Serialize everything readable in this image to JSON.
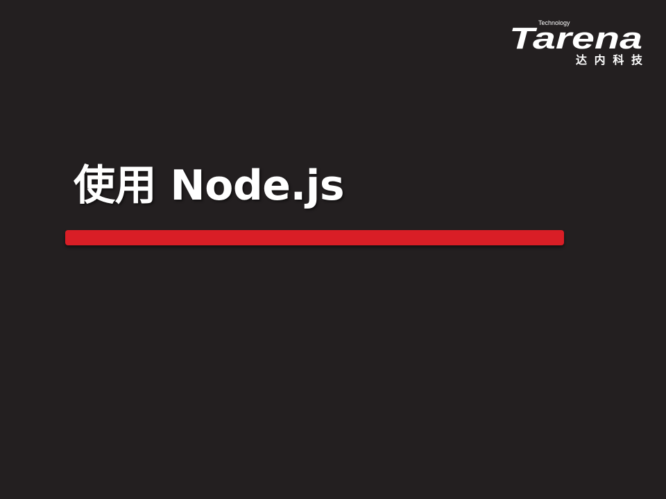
{
  "logo": {
    "tagline": "Technology",
    "brand": "Tarena",
    "cn_name": "达内科技"
  },
  "slide": {
    "title": "使用 Node.js"
  },
  "colors": {
    "background": "#231f20",
    "accent_bar": "#d91e26",
    "title_text": "#ffffff"
  }
}
